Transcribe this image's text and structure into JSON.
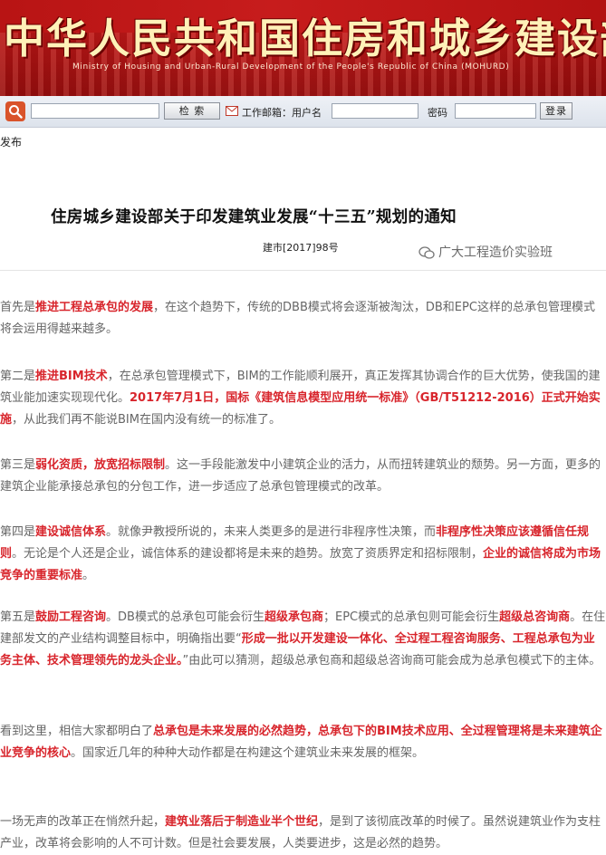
{
  "header": {
    "title": "中华人民共和国住房和城乡建设部",
    "subtitle": "Ministry of Housing and Urban-Rural Development of the People's Republic of China (MOHURD)"
  },
  "toolbar": {
    "search_button": "检 索",
    "email_label": "工作邮箱：用户名",
    "password_label": "密码",
    "login_button": "登录"
  },
  "publish_link": "发布",
  "notice": {
    "title": "住房城乡建设部关于印发建筑业发展“十三五”规划的通知",
    "doc_number": "建市[2017]98号",
    "watermark": "广大工程造价实验班"
  },
  "colors": {
    "accent": "#d8252c",
    "banner": "#c71c1c",
    "body_text": "#666666"
  },
  "article": {
    "p1": [
      "首先是",
      "推进工程总承包的发展",
      "，在这个趋势下，传统的DBB模式将会逐渐被淘汰，DB和EPC这样的总承包管理模式将会运用得越来越多。"
    ],
    "p2": [
      "第二是",
      "推进BIM技术",
      "，在总承包管理模式下，BIM的工作能顺利展开，真正发挥其协调合作的巨大优势，使我国的建筑业能加速实现现代化。",
      "2017年7月1日，国标《建筑信息模型应用统一标准》（GB/T51212-2016）正式开始实施",
      "，从此我们再不能说BIM在国内没有统一的标准了。"
    ],
    "p3": [
      "第三是",
      "弱化资质，放宽招标限制",
      "。这一手段能激发中小建筑企业的活力，从而扭转建筑业的颓势。另一方面，更多的建筑企业能承接总承包的分包工作，进一步适应了总承包管理模式的改革。"
    ],
    "p4": [
      "第四是",
      "建设诚信体系",
      "。就像尹教授所说的，未来人类更多的是进行非程序性决策，而",
      "非程序性决策应该遵循信任规则",
      "。无论是个人还是企业，诚信体系的建设都将是未来的趋势。放宽了资质界定和招标限制，",
      "企业的诚信将成为市场竞争的重要标准",
      "。"
    ],
    "p5": [
      "第五是",
      "鼓励工程咨询",
      "。DB模式的总承包可能会衍生",
      "超级承包商",
      "；EPC模式的总承包则可能会衍生",
      "超级总咨询商",
      "。在住建部发文的产业结构调整目标中，明确指出要“",
      "形成一批以开发建设一体化、全过程工程咨询服务、工程总承包为业务主体、技术管理领先的龙头企业。",
      "”由此可以猜测，超级总承包商和超级总咨询商可能会成为总承包模式下的主体。"
    ],
    "p6": [
      "看到这里，相信大家都明白了",
      "总承包是未来发展的必然趋势，总承包下的BIM技术应用、全过程管理将是未来建筑企业竞争的核心",
      "。国家近几年的种种大动作都是在构建这个建筑业未来发展的框架。"
    ],
    "p7": [
      "一场无声的改革正在悄然升起，",
      "建筑业落后于制造业半个世纪",
      "，是到了该彻底改革的时候了。虽然说建筑业作为支柱产业，改革将会影响的人不可计数。但是社会要发展，人类要进步，这是必然的趋势。"
    ]
  }
}
